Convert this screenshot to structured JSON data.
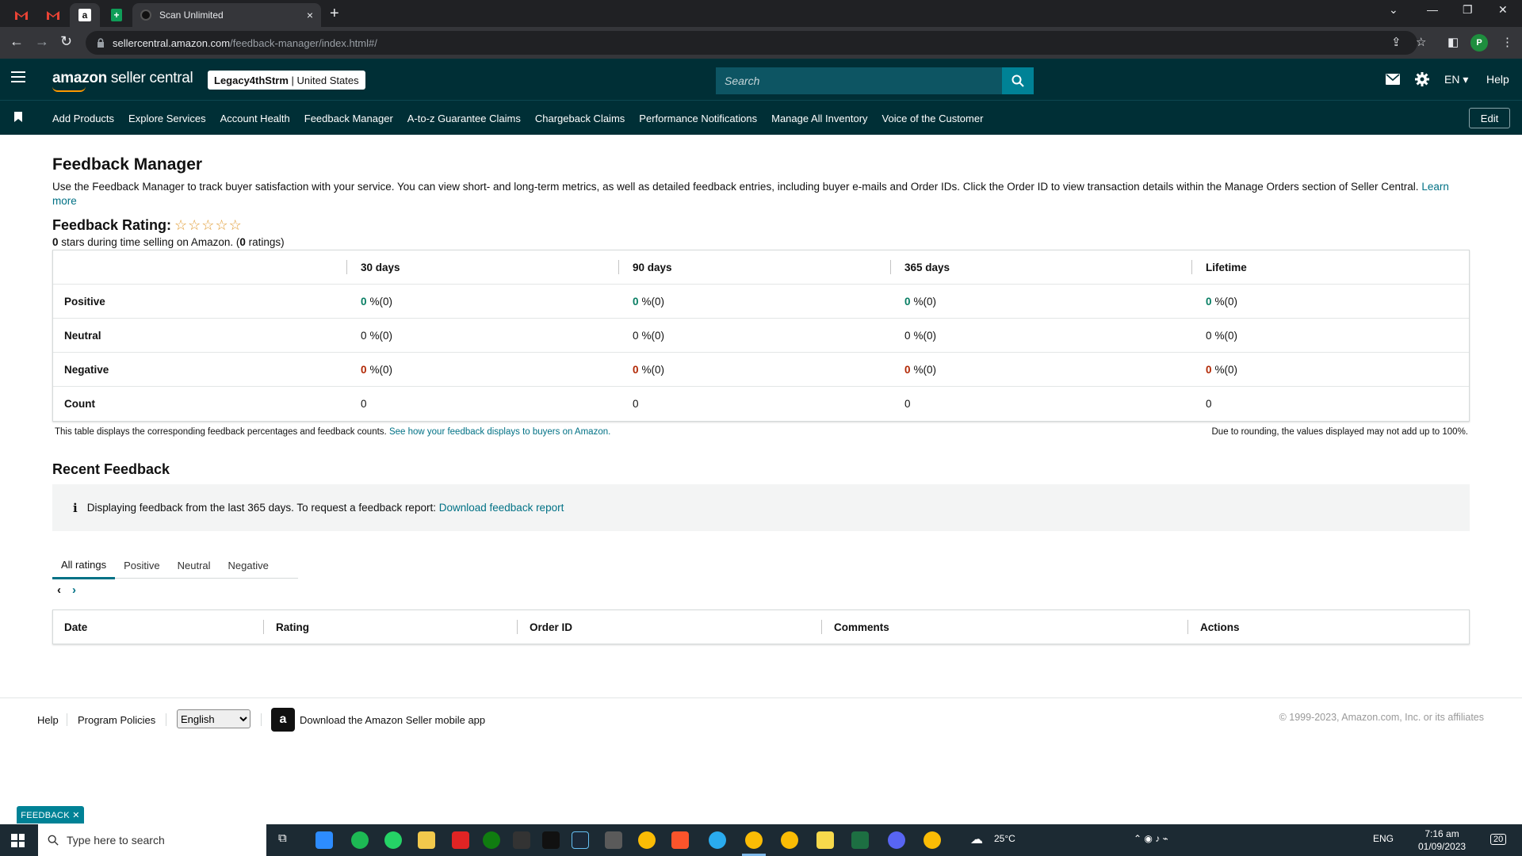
{
  "browser": {
    "tabs": [
      {
        "icon": "gmail-icon"
      },
      {
        "icon": "gmail-icon"
      },
      {
        "icon": "amazon-icon"
      },
      {
        "icon": "sheets-icon"
      }
    ],
    "active_tab": {
      "title": "Scan Unlimited",
      "close": "×"
    },
    "new_tab": "+",
    "url_host": "sellercentral.amazon.com",
    "url_path": "/feedback-manager/index.html#/",
    "profile_initial": "P"
  },
  "header": {
    "logo_prefix": "amazon",
    "logo_suffix": " seller central",
    "account_name": "Legacy4thStrm",
    "account_region": "United States",
    "search_placeholder": "Search",
    "language": "EN",
    "help": "Help"
  },
  "bookmarks": {
    "items": [
      "Add Products",
      "Explore Services",
      "Account Health",
      "Feedback Manager",
      "A-to-z Guarantee Claims",
      "Chargeback Claims",
      "Performance Notifications",
      "Manage All Inventory",
      "Voice of the Customer"
    ],
    "edit_label": "Edit"
  },
  "page": {
    "title": "Feedback Manager",
    "intro": "Use the Feedback Manager to track buyer satisfaction with your service. You can view short- and long-term metrics, as well as detailed feedback entries, including buyer e-mails and Order IDs. Click the Order ID to view transaction details within the Manage Orders section of Seller Central.",
    "learn_more": "Learn more",
    "rating_title": "Feedback Rating:",
    "rating_stars": "☆☆☆☆☆",
    "rating_stars_value": 0,
    "rating_sub_stars": "0",
    "rating_sub_text1": " stars during time selling on Amazon. (",
    "rating_sub_count": "0",
    "rating_sub_text2": " ratings)"
  },
  "feedback_table": {
    "headers": [
      "",
      "30 days",
      "90 days",
      "365 days",
      "Lifetime"
    ],
    "rows": [
      {
        "label": "Positive",
        "cells": [
          {
            "num": "0",
            "rest": "%(0)"
          },
          {
            "num": "0",
            "rest": "%(0)"
          },
          {
            "num": "0",
            "rest": "%(0)"
          },
          {
            "num": "0",
            "rest": "%(0)"
          }
        ],
        "color": "#067d62"
      },
      {
        "label": "Neutral",
        "cells": [
          {
            "num": "0",
            "rest": "%(0)"
          },
          {
            "num": "0",
            "rest": "%(0)"
          },
          {
            "num": "0",
            "rest": "%(0)"
          },
          {
            "num": "0",
            "rest": "%(0)"
          }
        ],
        "color": "#111111"
      },
      {
        "label": "Negative",
        "cells": [
          {
            "num": "0",
            "rest": "%(0)"
          },
          {
            "num": "0",
            "rest": "%(0)"
          },
          {
            "num": "0",
            "rest": "%(0)"
          },
          {
            "num": "0",
            "rest": "%(0)"
          }
        ],
        "color": "#b12704"
      },
      {
        "label": "Count",
        "cells": [
          {
            "num": "0",
            "rest": ""
          },
          {
            "num": "0",
            "rest": ""
          },
          {
            "num": "0",
            "rest": ""
          },
          {
            "num": "0",
            "rest": ""
          }
        ],
        "color": "#111111"
      }
    ],
    "note": "This table displays the corresponding feedback percentages and feedback counts.",
    "note_link": "See how your feedback displays to buyers on Amazon.",
    "note_right": "Due to rounding, the values displayed may not add up to 100%."
  },
  "recent": {
    "title": "Recent Feedback",
    "info_text": "Displaying feedback from the last 365 days. To request a feedback report:",
    "info_link": "Download feedback report",
    "tabs": [
      "All ratings",
      "Positive",
      "Neutral",
      "Negative"
    ],
    "active_tab": "All ratings",
    "prev": "‹",
    "next": "›",
    "columns": [
      "Date",
      "Rating",
      "Order ID",
      "Comments",
      "Actions"
    ]
  },
  "footer": {
    "help": "Help",
    "policies": "Program Policies",
    "language_select": "English",
    "app_badge": "a",
    "app_text": "Download the Amazon Seller mobile app",
    "copyright": "© 1999-2023, Amazon.com, Inc. or its affiliates",
    "feedback_tab": "FEEDBACK ✕"
  },
  "taskbar": {
    "search_placeholder": "Type here to search",
    "weather": "25°C",
    "lang": "ENG",
    "time": "7:16 am",
    "date": "01/09/2023",
    "notifications": "20"
  },
  "colors": {
    "header_bg": "#002f36",
    "accent": "#008296",
    "link": "#007185",
    "positive": "#067d62",
    "negative": "#b12704"
  }
}
